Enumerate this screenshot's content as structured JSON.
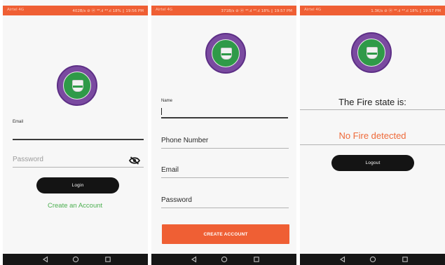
{
  "status_bar": {
    "carrier_text": "Airtel 4G",
    "screens": [
      {
        "info": "402B/s ⊘ ⓦ ⁴ᴳ.ıl ⁴ᴳ.ıl 18% ▯ 19:56 PM"
      },
      {
        "info": "371B/s ⊘ ⓦ ⁴ᴳ.ıl ⁴ᴳ.ıl 18% ▯ 19:57 PM"
      },
      {
        "info": "1.3K/s ⊘ ⓦ ⁴ᴳ.ıl ⁴ᴳ.ıl 18% ▯ 19:57 PM"
      }
    ]
  },
  "login": {
    "email_label": "Email",
    "email_value": "",
    "password_placeholder": "Password",
    "login_button": "Login",
    "create_account_link": "Create an Account"
  },
  "signup": {
    "name_label": "Name",
    "name_value": "",
    "phone_label": "Phone Number",
    "email_label": "Email",
    "password_label": "Password",
    "create_account_button": "CREATE ACCOUNT"
  },
  "status": {
    "title": "The Fire state is:",
    "state": "No Fire detected",
    "logout_button": "Logout"
  },
  "colors": {
    "accent": "#ef5f34",
    "link": "#4caf50",
    "button_dark": "#141414",
    "state_text": "#ee6a3a"
  },
  "icons": {
    "password_toggle": "eye-off-icon",
    "nav_back": "back-triangle-icon",
    "nav_home": "home-circle-icon",
    "nav_recents": "recents-square-icon"
  }
}
